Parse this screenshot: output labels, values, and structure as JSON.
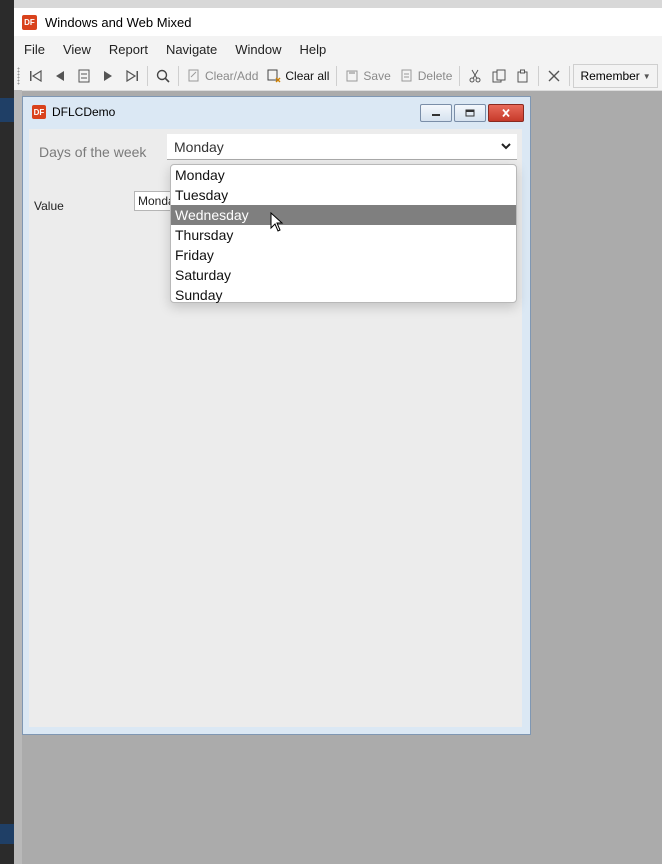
{
  "background": {
    "top_text": ""
  },
  "app": {
    "title": "Windows and Web Mixed",
    "logo": "DF",
    "menu": [
      "File",
      "View",
      "Report",
      "Navigate",
      "Window",
      "Help"
    ],
    "toolbar": {
      "clear_add": "Clear/Add",
      "clear_all": "Clear all",
      "save": "Save",
      "delete": "Delete",
      "remember": "Remember"
    }
  },
  "child": {
    "title": "DFLCDemo",
    "logo": "DF",
    "days_label": "Days of the week",
    "days_value": "Monday",
    "value_label": "Value",
    "value_field": "Monday",
    "options": [
      "Monday",
      "Tuesday",
      "Wednesday",
      "Thursday",
      "Friday",
      "Saturday",
      "Sunday"
    ],
    "selected_option": "Wednesday"
  },
  "colors": {
    "logo": "#d9421c",
    "highlight": "#7f7f7f",
    "child_frame": "#dbe8f4"
  }
}
